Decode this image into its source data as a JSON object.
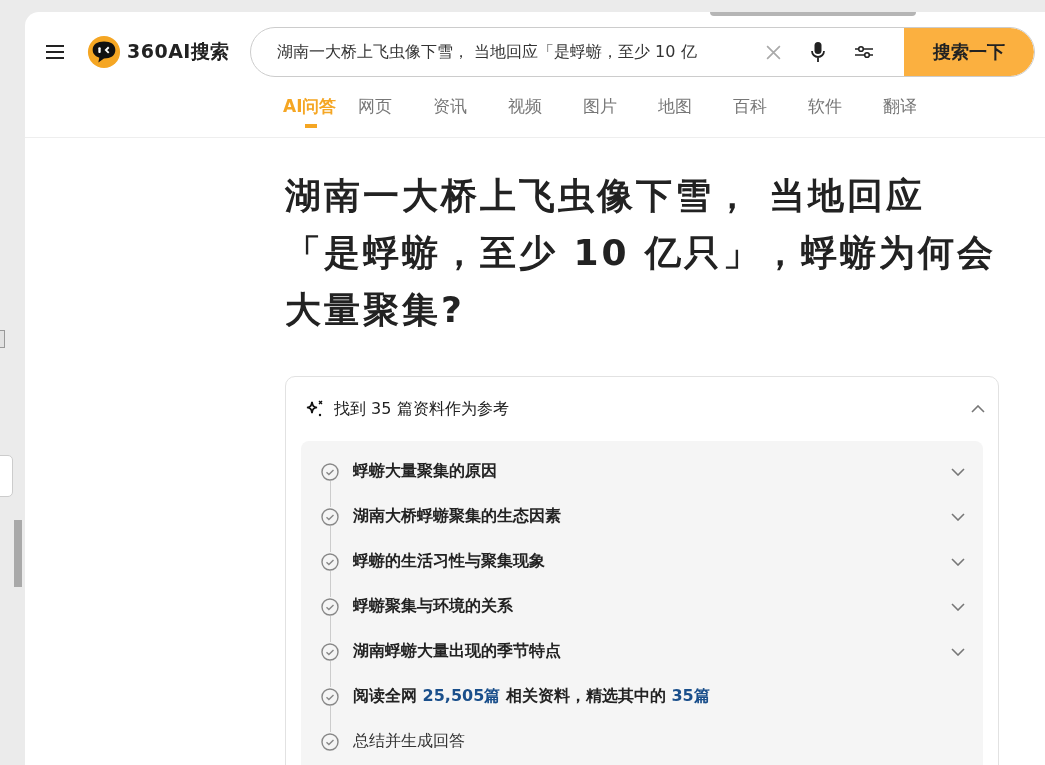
{
  "brand": {
    "name": "360AI搜索"
  },
  "search": {
    "value": "湖南一大桥上飞虫像下雪， 当地回应「是蜉蝣，至少 10 亿",
    "button": "搜索一下"
  },
  "tabs": [
    {
      "label": "AI问答",
      "selected": true
    },
    {
      "label": "网页",
      "selected": false
    },
    {
      "label": "资讯",
      "selected": false
    },
    {
      "label": "视频",
      "selected": false
    },
    {
      "label": "图片",
      "selected": false
    },
    {
      "label": "地图",
      "selected": false
    },
    {
      "label": "百科",
      "selected": false
    },
    {
      "label": "软件",
      "selected": false
    },
    {
      "label": "翻译",
      "selected": false
    }
  ],
  "question": "湖南一大桥上飞虫像下雪， 当地回应「是蜉蝣，至少 10 亿只」，蜉蝣为何会大量聚集?",
  "references": {
    "title": "找到 35 篇资料作为参考",
    "expanded": true,
    "steps": [
      {
        "kind": "topic",
        "text": "蜉蝣大量聚集的原因"
      },
      {
        "kind": "topic",
        "text": "湖南大桥蜉蝣聚集的生态因素"
      },
      {
        "kind": "topic",
        "text": "蜉蝣的生活习性与聚集现象"
      },
      {
        "kind": "topic",
        "text": "蜉蝣聚集与环境的关系"
      },
      {
        "kind": "topic",
        "text": "湖南蜉蝣大量出现的季节特点"
      },
      {
        "kind": "reading",
        "parts": [
          {
            "text": "阅读全网 ",
            "highlight": false
          },
          {
            "text": "25,505篇",
            "highlight": true
          },
          {
            "text": " 相关资料，精选其中的 ",
            "highlight": false
          },
          {
            "text": "35篇",
            "highlight": true
          }
        ]
      },
      {
        "kind": "final",
        "text": "总结并生成回答"
      }
    ]
  }
}
